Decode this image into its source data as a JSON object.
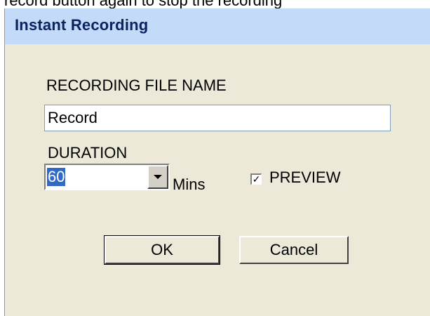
{
  "caption": "record button again to stop the recording",
  "dialog": {
    "title": "Instant Recording",
    "file_name_label": "RECORDING FILE NAME",
    "file_name_value": "Record",
    "duration_label": "DURATION",
    "duration_value": "60",
    "duration_unit": "Mins",
    "preview_label": "PREVIEW",
    "preview_checked": true,
    "ok_label": "OK",
    "cancel_label": "Cancel"
  }
}
